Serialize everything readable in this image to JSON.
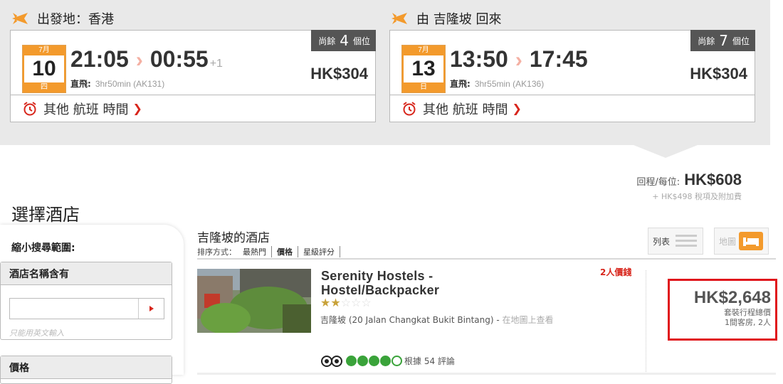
{
  "outbound": {
    "heading": "出發地：香港",
    "remaining_prefix": "尚餘",
    "remaining_count": "4",
    "remaining_suffix": "個位",
    "month": "7月",
    "day": "10",
    "weekday": "四",
    "depart": "21:05",
    "arrive": "00:55",
    "day_offset": "+1",
    "direct_label": "直飛:",
    "duration": "3hr50min (AK131)",
    "price": "HK$304",
    "other_times": "其他 航班 時間"
  },
  "inbound": {
    "heading": "由 吉隆坡 回來",
    "remaining_prefix": "尚餘",
    "remaining_count": "7",
    "remaining_suffix": "個位",
    "month": "7月",
    "day": "13",
    "weekday": "日",
    "depart": "13:50",
    "arrive": "17:45",
    "direct_label": "直飛:",
    "duration": "3hr55min (AK136)",
    "price": "HK$304",
    "other_times": "其他 航班 時間"
  },
  "summary": {
    "label": "回程/每位:",
    "total": "HK$608",
    "extras": "+ HK$498 稅項及附加費"
  },
  "hotels_section": {
    "title": "選擇酒店"
  },
  "sidebar": {
    "narrow_label": "縮小搜尋範圍:",
    "name_filter_title": "酒店名稱含有",
    "name_filter_value": "",
    "name_filter_hint": "只能用英文輸入",
    "price_filter_title": "價格"
  },
  "results": {
    "title": "吉隆坡的酒店",
    "sort_label": "排序方式：",
    "sort_options": [
      "最熱門",
      "價格",
      "星級評分"
    ],
    "view_list": "列表",
    "view_map": "地圖"
  },
  "hotel": {
    "name": "Serenity Hostels - Hostel/Backpacker",
    "stars": 2,
    "max_stars": 5,
    "address": "吉隆坡 (20 Jalan Changkat Bukit Bintang) - ",
    "map_link": "在地圖上查看",
    "review_label": "根據 54 評論",
    "two_person_label": "2人價錢",
    "price": "HK$2,648",
    "price_sub1": "套裝行程總價",
    "price_sub2": "1間客房, 2人"
  },
  "colors": {
    "accent_orange": "#f39a2c",
    "highlight_red": "#e0161c",
    "tripadvisor_green": "#3aa33a",
    "band_gray": "#e9e9e9"
  }
}
